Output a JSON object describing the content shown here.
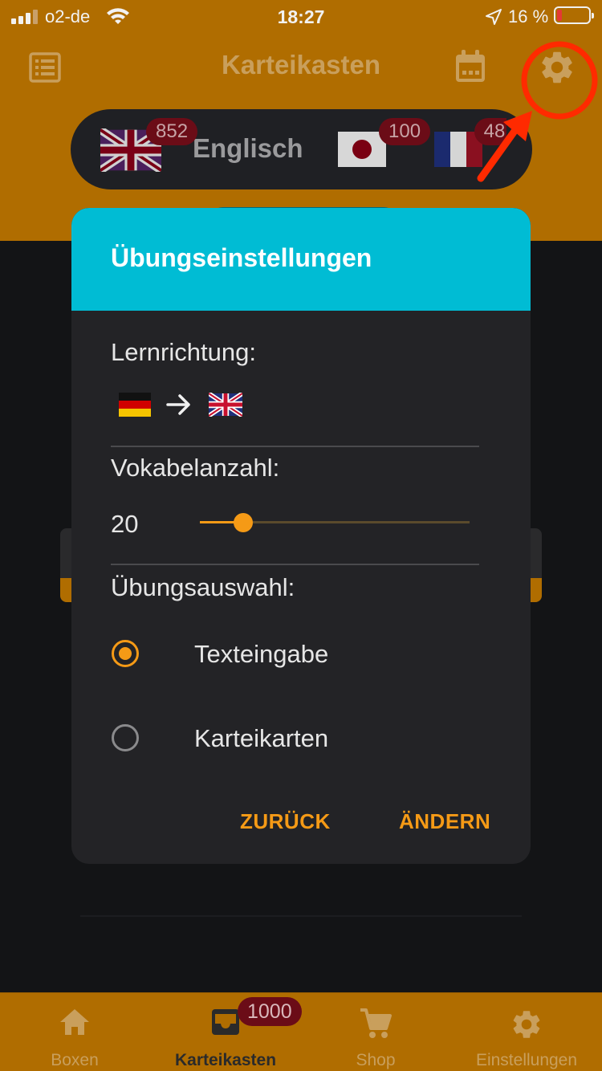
{
  "status_bar": {
    "carrier": "o2-de",
    "time": "18:27",
    "battery_percent": "16 %",
    "battery_level": 0.16
  },
  "header": {
    "title": "Karteikasten"
  },
  "languages": [
    {
      "name": "Englisch",
      "badge": "852",
      "flag": "uk-flag"
    },
    {
      "name": "",
      "badge": "100",
      "flag": "japan-flag"
    },
    {
      "name": "",
      "badge": "48",
      "flag": "france-flag"
    }
  ],
  "dialog": {
    "title": "Übungseinstellungen",
    "direction_label": "Lernrichtung:",
    "direction_from": "german-flag",
    "direction_to": "uk-flag",
    "count_label": "Vokabelanzahl:",
    "count_value": "20",
    "count_slider_fraction": 0.16,
    "choice_label": "Übungsauswahl:",
    "options": [
      {
        "label": "Texteingabe",
        "selected": true
      },
      {
        "label": "Karteikarten",
        "selected": false
      }
    ],
    "back_label": "ZURÜCK",
    "change_label": "ÄNDERN"
  },
  "tabs": [
    {
      "label": "Boxen",
      "icon": "home-icon",
      "active": false
    },
    {
      "label": "Karteikasten",
      "icon": "inbox-icon",
      "active": true,
      "badge": "1000"
    },
    {
      "label": "Shop",
      "icon": "cart-icon",
      "active": false
    },
    {
      "label": "Einstellungen",
      "icon": "gear-icon",
      "active": false
    }
  ],
  "colors": {
    "accent": "#f59a16",
    "header": "#b06d00",
    "dialog_header": "#00bcd4",
    "badge": "#6b0c17",
    "annotation": "#ff2a00"
  }
}
